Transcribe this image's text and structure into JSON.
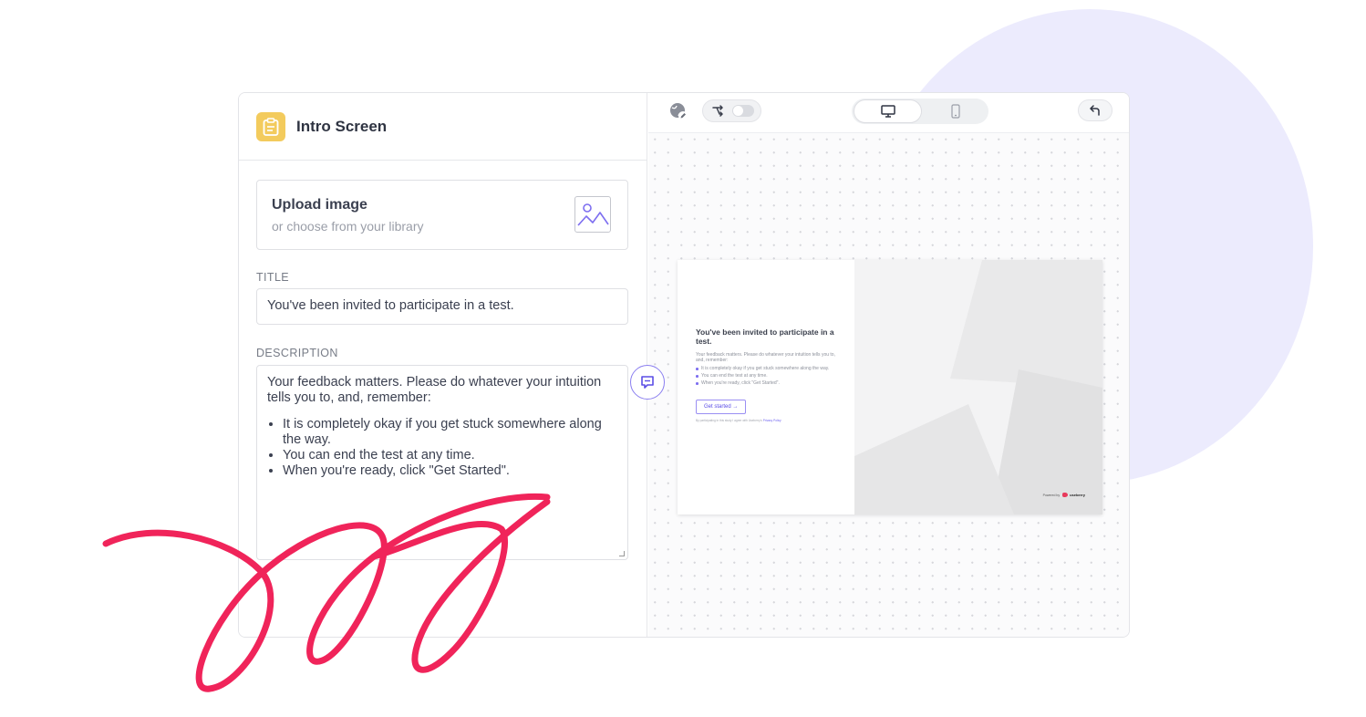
{
  "editor": {
    "screen_title": "Intro Screen",
    "upload": {
      "title": "Upload image",
      "subtitle": "or choose from your library"
    },
    "title_label": "TITLE",
    "title_value": "You've been invited to participate in a test.",
    "description_label": "DESCRIPTION",
    "description_intro": "Your feedback matters. Please do whatever your intuition tells you to, and, remember:",
    "description_items": [
      "It is completely okay if you get stuck somewhere along the way.",
      "You can end the test at any time.",
      "When you're ready, click \"Get Started\"."
    ]
  },
  "preview": {
    "title": "You've been invited to participate in a test.",
    "description": "Your feedback matters. Please do whatever your intuition tells you to, and, remember:",
    "items": [
      "It is completely okay if you get stuck somewhere along the way.",
      "You can end the test at any time.",
      "When you're ready, click \"Get Started\"."
    ],
    "button_label": "Get started →",
    "consent_prefix": "By participating in this study I agree with Useberry's",
    "consent_link": "Privacy Policy",
    "powered_by": "Powered by",
    "brand": "useberry"
  },
  "colors": {
    "accent": "#7d6ef0",
    "clipboard": "#f3cb5d",
    "scribble": "#f0245a",
    "blob": "#ecebfd"
  },
  "icons": [
    "clipboard-icon",
    "image-icon",
    "comment-icon",
    "globe-edit-icon",
    "branch-icon",
    "desktop-icon",
    "mobile-icon",
    "undo-icon"
  ]
}
